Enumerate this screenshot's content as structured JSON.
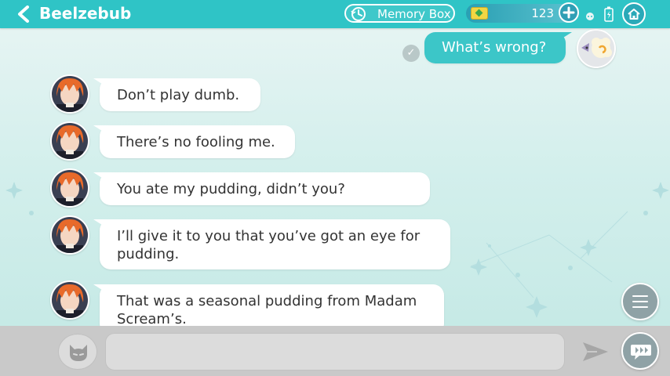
{
  "header": {
    "title": "Beelzebub",
    "memory_box_label": "Memory Box",
    "currency_count": "123"
  },
  "messages": [
    {
      "sender": "me",
      "text": "What’s wrong?",
      "read": true
    },
    {
      "sender": "Beelzebub",
      "text": "Don’t play dumb."
    },
    {
      "sender": "Beelzebub",
      "text": "There’s no fooling me."
    },
    {
      "sender": "Beelzebub",
      "text": "You ate my pudding, didn’t you?"
    },
    {
      "sender": "Beelzebub",
      "text": "I’ll give it to you that you’ve got an eye for pudding."
    },
    {
      "sender": "Beelzebub",
      "text": "That was a seasonal pudding from Madam Scream’s."
    }
  ],
  "read_mark": "✓",
  "input": {
    "placeholder": ""
  },
  "colors": {
    "accent": "#2fc4c6",
    "bubble_mine": "#3cc6c8",
    "input_bar": "#c9c9c9"
  },
  "icons": [
    "back-arrow-icon",
    "clock-icon",
    "gem-icon",
    "plus-icon",
    "ghost-icon",
    "battery-icon",
    "home-icon",
    "menu-icon",
    "cat-stamp-icon",
    "send-icon",
    "skip-icon"
  ]
}
